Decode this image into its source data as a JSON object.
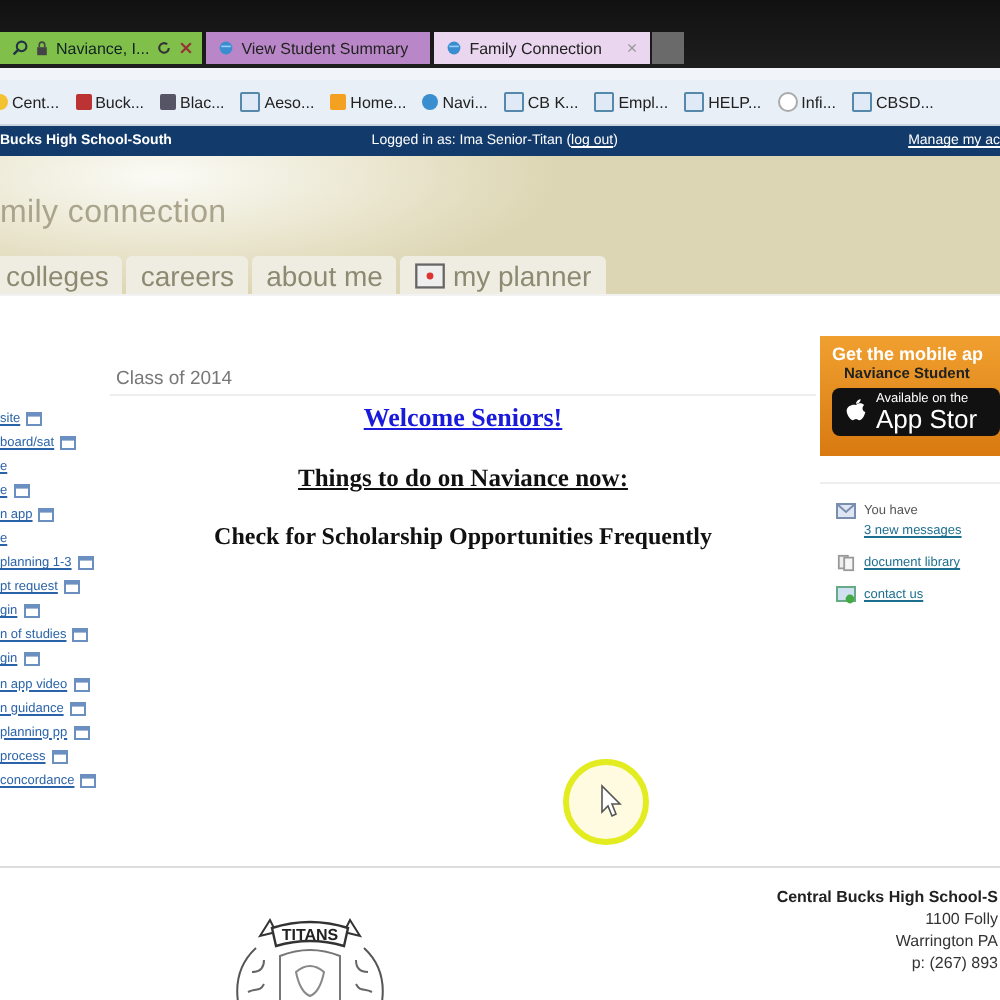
{
  "address_bar": {
    "text": "Naviance, I..."
  },
  "browser_tabs": [
    {
      "title": "View Student Summary",
      "selected": false
    },
    {
      "title": "Family Connection",
      "selected": true,
      "close": "×"
    }
  ],
  "bookmarks": [
    {
      "label": "Cent...",
      "kind": "sun"
    },
    {
      "label": "Buck...",
      "kind": "plant"
    },
    {
      "label": "Blac...",
      "kind": "box"
    },
    {
      "label": "Aeso...",
      "kind": "page"
    },
    {
      "label": "Home...",
      "kind": "grid"
    },
    {
      "label": "Navi...",
      "kind": "globe"
    },
    {
      "label": "CB K...",
      "kind": "page"
    },
    {
      "label": "Empl...",
      "kind": "page"
    },
    {
      "label": "HELP...",
      "kind": "page"
    },
    {
      "label": "Infi...",
      "kind": "circle"
    },
    {
      "label": "CBSD...",
      "kind": "page"
    }
  ],
  "header": {
    "school": "Bucks High School-South",
    "login": "Logged in as: Ima Senior-Titan (",
    "logout": "log out",
    "login_end": ")",
    "manage": "Manage my ac"
  },
  "banner": {
    "title": "mily connection"
  },
  "nav_tabs": [
    {
      "label": "colleges",
      "icon": false
    },
    {
      "label": "careers",
      "icon": false
    },
    {
      "label": "about me",
      "icon": false
    },
    {
      "label": "my planner",
      "icon": true
    }
  ],
  "sidebar": {
    "links": [
      {
        "label": "site",
        "icon": true
      },
      {
        "label": "board/sat",
        "icon": true
      },
      {
        "label": "e",
        "icon": false
      },
      {
        "label": "e",
        "icon": true
      },
      {
        "label": "n app",
        "icon": true
      },
      {
        "label": "e",
        "icon": false
      },
      {
        "label": "planning 1-3",
        "icon": true
      },
      {
        "label": "pt request",
        "icon": true
      },
      {
        "label": "gin",
        "icon": true
      },
      {
        "label": "n of studies",
        "icon": true
      },
      {
        "label": "gin",
        "icon": true
      },
      {
        "label": "n app video",
        "icon": true
      },
      {
        "label": "n guidance",
        "icon": true
      },
      {
        "label": "planning pp",
        "icon": true
      },
      {
        "label": "process",
        "icon": true
      },
      {
        "label": "concordance",
        "icon": true
      }
    ]
  },
  "main": {
    "class_label": "Class of 2014",
    "welcome": "Welcome Seniors!",
    "things": "Things to do on Naviance now:",
    "check": "Check for Scholarship Opportunities Frequently"
  },
  "promo": {
    "line1": "Get the mobile ap",
    "line2": "Naviance Student",
    "small": "Available on the",
    "store": "App Stor"
  },
  "quick_links": [
    {
      "kind": "mail",
      "prefix": "You have ",
      "label": "3 new messages"
    },
    {
      "kind": "docs",
      "label": "document library"
    },
    {
      "kind": "contact",
      "label": "contact us"
    }
  ],
  "footer": {
    "name": "Central Bucks High School-S",
    "lines": [
      "1100 Folly",
      "Warrington PA",
      "p: (267) 893"
    ],
    "crest_banner": "TITANS"
  }
}
